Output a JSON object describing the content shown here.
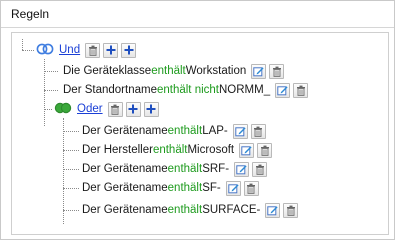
{
  "panel": {
    "title": "Regeln"
  },
  "tree": {
    "root": {
      "label": "Und"
    },
    "rules": [
      {
        "prefix": "Die Geräteklasse ",
        "operator": "enthält",
        "value": " Workstation"
      },
      {
        "prefix": "Der Standortname ",
        "operator": "enthält nicht",
        "value": " NORMM_"
      }
    ],
    "subgroup": {
      "label": "Oder",
      "rules": [
        {
          "prefix": "Der Gerätename ",
          "operator": "enthält",
          "value": " LAP-"
        },
        {
          "prefix": "Der Hersteller ",
          "operator": "enthält",
          "value": " Microsoft"
        },
        {
          "prefix": "Der Gerätename ",
          "operator": "enthält",
          "value": " SRF-"
        },
        {
          "prefix": "Der Gerätename ",
          "operator": "enthält",
          "value": " SF-"
        },
        {
          "prefix": "Der Gerätename ",
          "operator": "enthält",
          "value": " SURFACE-"
        }
      ]
    }
  },
  "icons": {
    "group": "venn-circles-icon",
    "delete": "trash-icon",
    "add": "plus-icon",
    "edit": "edit-pencil-icon"
  },
  "colors": {
    "operator": "#1c9a1c",
    "link": "#1a3fd6",
    "group_blue": "#3f7de0",
    "group_green": "#3aa83a"
  }
}
